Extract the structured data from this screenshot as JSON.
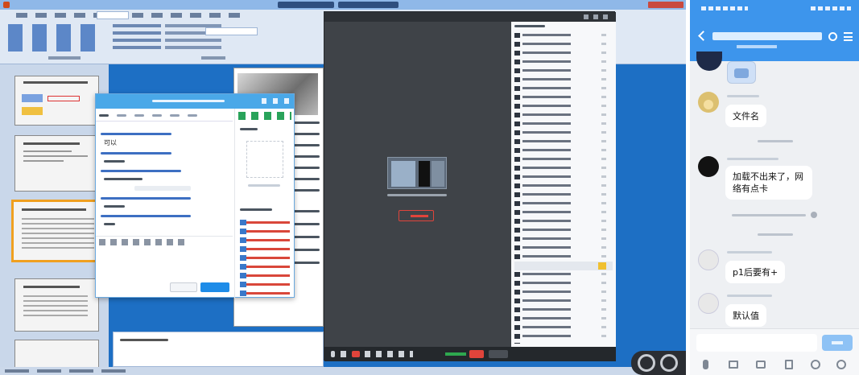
{
  "colors": {
    "desktop_bg": "#1d6fc4",
    "ribbon_bg": "#dfe8f4",
    "meeting_bg": "#3b3f44",
    "qq_header": "#4aa8e8",
    "phone_header": "#3d95ec",
    "phone_bg": "#eef0f3",
    "video_btn": "#e0443b"
  },
  "qq": {
    "messages": [
      "可以"
    ]
  },
  "phone": {
    "messages": [
      {
        "text": "文件名"
      },
      {
        "text": "加载不出来了，网络有点卡"
      },
      {
        "text": "p1后要有+"
      },
      {
        "text": "默认值"
      }
    ]
  }
}
